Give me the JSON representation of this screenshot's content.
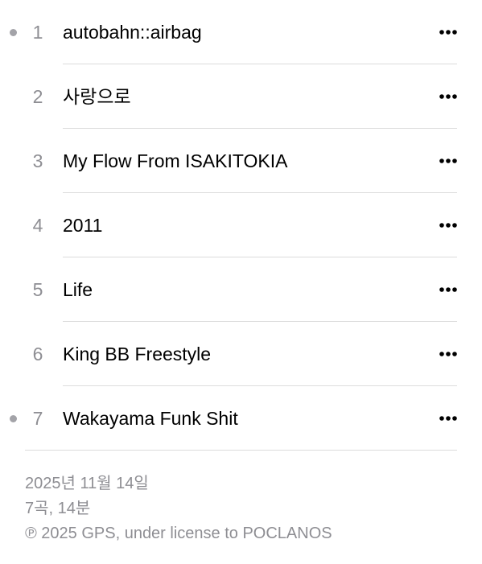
{
  "tracks": [
    {
      "number": "1",
      "title": "autobahn::airbag",
      "dot": true
    },
    {
      "number": "2",
      "title": "사랑으로",
      "dot": false
    },
    {
      "number": "3",
      "title": "My Flow From ISAKITOKIA",
      "dot": false
    },
    {
      "number": "4",
      "title": "2011",
      "dot": false
    },
    {
      "number": "5",
      "title": "Life",
      "dot": false
    },
    {
      "number": "6",
      "title": "King BB Freestyle",
      "dot": false
    },
    {
      "number": "7",
      "title": "Wakayama Funk Shit",
      "dot": true
    }
  ],
  "more_icon": "ellipsis-icon",
  "album_info": {
    "release_date": "2025년 11월 14일",
    "summary": "7곡, 14분",
    "copyright": "℗ 2025 GPS, under license to POCLANOS"
  },
  "colors": {
    "dot": "#a3a3a8",
    "secondary_text": "#8e8e93",
    "divider": "#dcdcdc"
  }
}
